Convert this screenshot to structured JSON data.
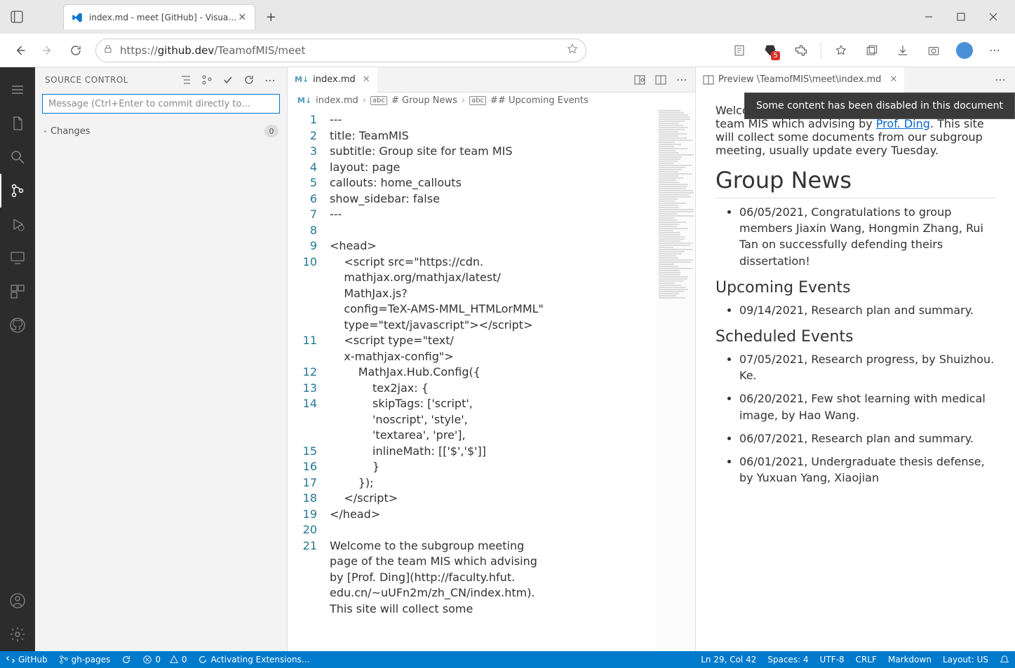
{
  "window": {
    "tab_title": "index.md - meet [GitHub] - Visua…",
    "url_prefix": "https://",
    "url_host": "github.dev",
    "url_path": "/TeamofMIS/meet"
  },
  "ext_badge": "5",
  "sidebar": {
    "title": "SOURCE CONTROL",
    "commit_placeholder": "Message (Ctrl+Enter to commit directly to…",
    "changes_label": "Changes",
    "changes_count": "0"
  },
  "editor": {
    "tab": "index.md",
    "breadcrumb": {
      "file": "index.md",
      "sec1": "# Group News",
      "sec2": "## Upcoming Events"
    },
    "lines": [
      "---",
      "title: TeamMIS",
      "subtitle: Group site for team MIS",
      "layout: page",
      "callouts: home_callouts",
      "show_sidebar: false",
      "---",
      "",
      "<head>",
      "    <script src=\"https://cdn.",
      "    mathjax.org/mathjax/latest/",
      "    MathJax.js?",
      "    config=TeX-AMS-MML_HTMLorMML\"",
      "    type=\"text/javascript\"></scr ipt>",
      "    <script type=\"text/",
      "    x-mathjax-config\">",
      "        MathJax.Hub.Config({",
      "            tex2jax: {",
      "            skipTags: ['script',",
      "            'noscript', 'style',",
      "            'textarea', 'pre'],",
      "            inlineMath: [['$','$']]",
      "            }",
      "        });",
      "    </scr ipt>",
      "</head>",
      "",
      "Welcome to the subgroup meeting",
      "page of the team MIS which advising",
      "by [Prof. Ding](http://faculty.hfut.",
      "edu.cn/~uUFn2m/zh_CN/index.htm).",
      "This site will collect some"
    ],
    "line_numbers": [
      "1",
      "2",
      "3",
      "4",
      "5",
      "6",
      "7",
      "8",
      "9",
      "10",
      "",
      "",
      "",
      "",
      "11",
      "",
      "12",
      "13",
      "14",
      "",
      "",
      "15",
      "16",
      "17",
      "18",
      "19",
      "20",
      "21",
      "",
      "",
      "",
      ""
    ]
  },
  "preview": {
    "tab": "Preview \\TeamofMIS\\meet\\index.md",
    "toast": "Some content has been disabled in this document",
    "intro_pre": "Welcome to the subgroup meeting page of the team MIS which advising by ",
    "intro_link": "Prof. Ding",
    "intro_post": ". This site will collect some documents from our subgroup meeting, usually update every Tuesday.",
    "h1": "Group News",
    "news1": "06/05/2021, Congratulations to group members Jiaxin Wang, Hongmin Zhang, Rui Tan on successfully defending theirs dissertation!",
    "h2a": "Upcoming Events",
    "up1": "09/14/2021, Research plan and summary.",
    "h2b": "Scheduled Events",
    "s1": "07/05/2021, Research progress, by Shuizhou. Ke.",
    "s2": "06/20/2021, Few shot learning with medical image, by Hao Wang.",
    "s3": "06/07/2021, Research plan and summary.",
    "s4": "06/01/2021, Undergraduate thesis defense, by Yuxuan Yang, Xiaojian"
  },
  "status": {
    "remote": "GitHub",
    "branch": "gh-pages",
    "errors": "0",
    "warnings": "0",
    "ext": "Activating Extensions…",
    "cursor": "Ln 29, Col 42",
    "spaces": "Spaces: 4",
    "enc": "UTF-8",
    "eol": "CRLF",
    "lang": "Markdown",
    "layout": "Layout: US"
  }
}
